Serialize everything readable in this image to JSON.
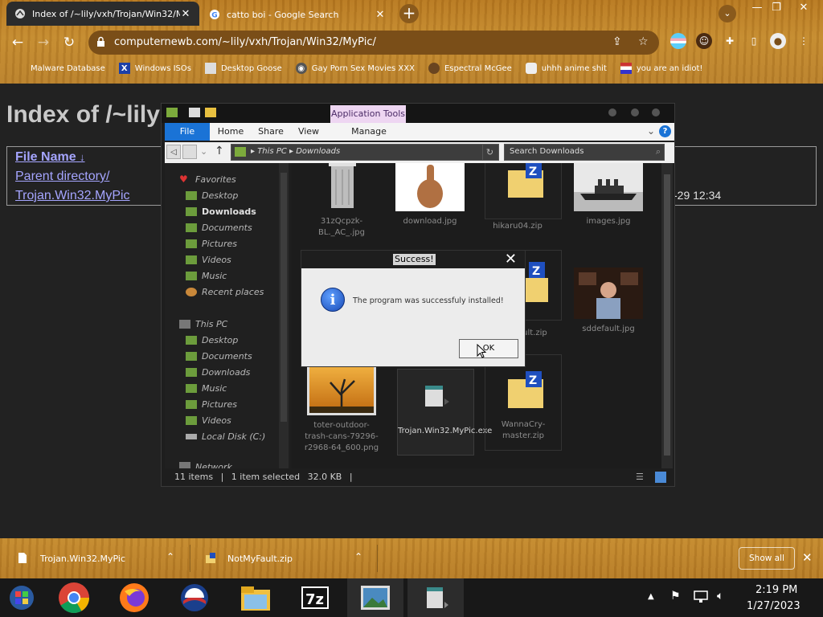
{
  "browser": {
    "tabs": [
      {
        "title": "Index of /~lily/vxh/Trojan/Win32/MyPic/",
        "active": true
      },
      {
        "title": "catto boi - Google Search",
        "active": false
      }
    ],
    "url": "computernewb.com/~lily/vxh/Trojan/Win32/MyPic/",
    "bookmarks": [
      {
        "label": "Malware Database",
        "icon": "folder-icon"
      },
      {
        "label": "Windows ISOs",
        "icon": "x-icon"
      },
      {
        "label": "Desktop Goose",
        "icon": "image-icon"
      },
      {
        "label": "Gay Porn Sex Movies XXX",
        "icon": "globe-icon"
      },
      {
        "label": "Espectral McGee",
        "icon": "avatar-icon"
      },
      {
        "label": "uhhh anime shit",
        "icon": "anime-icon"
      },
      {
        "label": "you are an idiot!",
        "icon": "flag-icon"
      }
    ]
  },
  "webpage": {
    "heading": "Index of /~lily",
    "col_name": "File Name",
    "sort_glyph": "↓",
    "links": [
      "Parent directory/",
      "Trojan.Win32.MyPic"
    ],
    "date_fragment": "-29 12:34"
  },
  "explorer": {
    "app_tools": "Application Tools",
    "ribbon_tabs": [
      "File",
      "Home",
      "Share",
      "View",
      "Manage"
    ],
    "breadcrumb": [
      "This PC",
      "Downloads"
    ],
    "search_placeholder": "Search Downloads",
    "nav": {
      "favorites": "Favorites",
      "fav_items": [
        "Desktop",
        "Downloads",
        "Documents",
        "Pictures",
        "Videos",
        "Music",
        "Recent places"
      ],
      "this_pc": "This PC",
      "pc_items": [
        "Desktop",
        "Documents",
        "Downloads",
        "Music",
        "Pictures",
        "Videos",
        "Local Disk (C:)"
      ],
      "network": "Network"
    },
    "files": [
      {
        "name": "31zQcpzk-BL._AC_.jpg"
      },
      {
        "name": "download.jpg"
      },
      {
        "name": "hikaru04.zip"
      },
      {
        "name": "images.jpg"
      },
      {
        "name": "ault.zip"
      },
      {
        "name": "sddefault.jpg"
      },
      {
        "name": "toter-outdoor-trash-cans-79296-r2968-64_600.png"
      },
      {
        "name": "Trojan.Win32.MyPic.exe"
      },
      {
        "name": "WannaCry-master.zip"
      }
    ],
    "status": {
      "items": "11 items",
      "selected": "1 item selected",
      "size": "32.0 KB"
    }
  },
  "dialog": {
    "title": "Success!",
    "message": "The program was successfuly installed!",
    "ok": "OK"
  },
  "downloads": {
    "items": [
      "Trojan.Win32.MyPic",
      "NotMyFault.zip"
    ],
    "show_all": "Show all"
  },
  "taskbar": {
    "time": "2:19 PM",
    "date": "1/27/2023"
  },
  "colors": {
    "chrome_wood": "#c48a2d",
    "link": "#a5a5ff",
    "ribbon_file": "#1a73d6",
    "app_tools": "#eed6f2"
  }
}
